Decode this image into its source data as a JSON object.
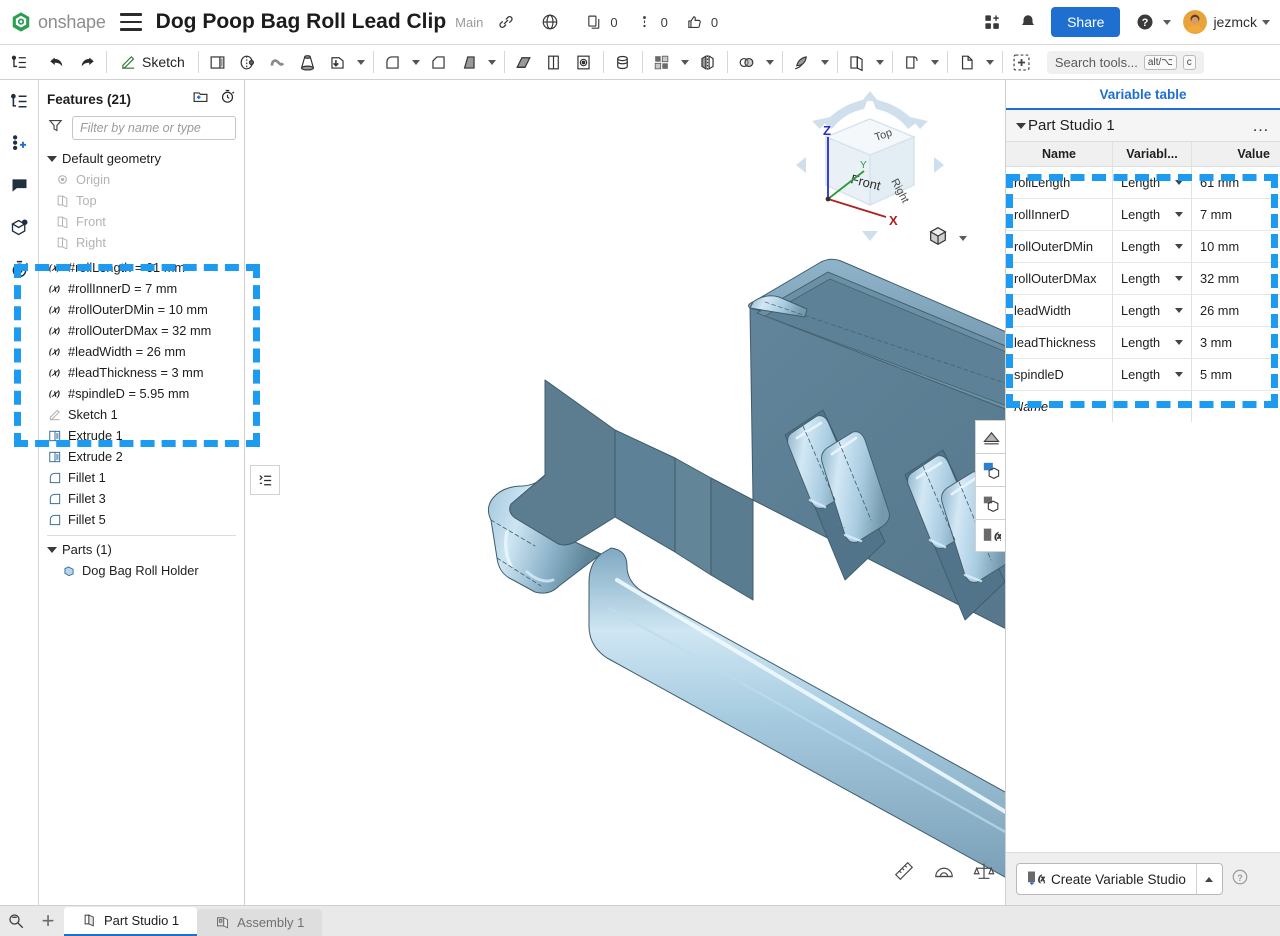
{
  "topbar": {
    "logo_text": "onshape",
    "menu_icon": "hamburger-icon",
    "doc_title": "Dog Poop Bag Roll Lead Clip",
    "branch": "Main",
    "link_icon": "link-icon",
    "globe_icon": "globe-icon",
    "copy_count": "0",
    "comment_count": "0",
    "like_count": "0",
    "apps_icon": "apps-grid-icon",
    "bell_icon": "notification-icon",
    "share_label": "Share",
    "help_icon": "help-icon",
    "username": "jezmck"
  },
  "feature_toolbar": {
    "tree_icon": "feature-tree-icon",
    "undo_icon": "undo-icon",
    "redo_icon": "redo-icon",
    "sketch_label": "Sketch",
    "tools": [
      "extrude-icon",
      "revolve-icon",
      "sweep-icon",
      "loft-icon",
      "thicken-icon",
      "fillet-icon",
      "chamfer-icon",
      "draft-icon",
      "shell-icon",
      "rib-icon",
      "hole-icon",
      "boolean-icon",
      "pattern-icon",
      "mirror-icon",
      "transform-icon",
      "split-icon",
      "plane-icon",
      "sheet-metal-icon",
      "insert-icon"
    ],
    "search_placeholder": "Search tools...",
    "search_kbd_1": "alt/⌥",
    "search_kbd_2": "c"
  },
  "left_rail": {
    "items": [
      {
        "name": "feature-list-icon"
      },
      {
        "name": "add-instance-icon"
      },
      {
        "name": "comments-icon"
      },
      {
        "name": "versions-icon"
      },
      {
        "name": "history-icon"
      }
    ]
  },
  "feature_tree": {
    "title": "Features (21)",
    "new_folder_icon": "new-folder-icon",
    "rollback_icon": "rollback-timer-icon",
    "filter_icon": "filter-icon",
    "filter_placeholder": "Filter by name or type",
    "default_geometry_label": "Default geometry",
    "default_geometry": [
      {
        "label": "Origin",
        "icon": "origin-icon"
      },
      {
        "label": "Top",
        "icon": "plane-icon"
      },
      {
        "label": "Front",
        "icon": "plane-icon"
      },
      {
        "label": "Right",
        "icon": "plane-icon"
      }
    ],
    "variables": [
      {
        "label": "#rollLength = 61 mm",
        "icon": "variable-icon"
      },
      {
        "label": "#rollInnerD = 7 mm",
        "icon": "variable-icon"
      },
      {
        "label": "#rollOuterDMin = 10 mm",
        "icon": "variable-icon"
      },
      {
        "label": "#rollOuterDMax = 32 mm",
        "icon": "variable-icon"
      },
      {
        "label": "#leadWidth = 26 mm",
        "icon": "variable-icon"
      },
      {
        "label": "#leadThickness = 3 mm",
        "icon": "variable-icon"
      },
      {
        "label": "#spindleD = 5.95 mm",
        "icon": "variable-icon"
      }
    ],
    "features": [
      {
        "label": "Sketch 1",
        "icon": "sketch-icon",
        "dim": true
      },
      {
        "label": "Extrude 1",
        "icon": "extrude-icon",
        "dim": false
      },
      {
        "label": "Extrude 2",
        "icon": "extrude-icon",
        "dim": false
      },
      {
        "label": "Fillet 1",
        "icon": "fillet-icon",
        "dim": false
      },
      {
        "label": "Fillet 3",
        "icon": "fillet-icon",
        "dim": false
      },
      {
        "label": "Fillet 5",
        "icon": "fillet-icon",
        "dim": false
      }
    ],
    "parts_label": "Parts (1)",
    "parts": [
      {
        "label": "Dog Bag Roll Holder",
        "icon": "part-icon"
      }
    ]
  },
  "viewport": {
    "viewcube": {
      "top_face": "Top",
      "front_face": "Front",
      "right_face": "Right",
      "axis_z": "Z",
      "axis_y": "Y",
      "axis_x": "X"
    },
    "view_dropdown_icon": "view-orientation-icon",
    "tree_toggle_icon": "feature-list-toggle-icon",
    "right_tools": [
      "section-view-icon",
      "render-studio-icon",
      "display-state-icon",
      "variable-studio-icon"
    ],
    "bottom_tools": [
      "measure-icon",
      "protractor-icon",
      "mass-properties-icon"
    ],
    "model_colors": {
      "face_dark": "#5b7d8f",
      "face_mid": "#8fb6cc",
      "face_light": "#b9d6e8",
      "edge": "#3f5c6b"
    }
  },
  "variable_panel": {
    "tab_label": "Variable table",
    "studio_name": "Part Studio 1",
    "more_icon": "more-options-icon",
    "columns": [
      "Name",
      "Variabl...",
      "Value"
    ],
    "rows": [
      {
        "name": "rollLength",
        "type": "Length",
        "value": "61 mm"
      },
      {
        "name": "rollInnerD",
        "type": "Length",
        "value": "7 mm"
      },
      {
        "name": "rollOuterDMin",
        "type": "Length",
        "value": "10 mm"
      },
      {
        "name": "rollOuterDMax",
        "type": "Length",
        "value": "32 mm"
      },
      {
        "name": "leadWidth",
        "type": "Length",
        "value": "26 mm"
      },
      {
        "name": "leadThickness",
        "type": "Length",
        "value": "3 mm"
      },
      {
        "name": "spindleD",
        "type": "Length",
        "value": "5 mm"
      }
    ],
    "new_row_placeholder": "Name",
    "create_button_label": "Create Variable Studio",
    "create_button_icon": "variable-studio-icon",
    "help_icon": "help-circle-icon"
  },
  "bottom_bar": {
    "search_icon": "search-document-icon",
    "add_tab_label": "+",
    "tabs": [
      {
        "label": "Part Studio 1",
        "icon": "part-studio-icon",
        "active": true
      },
      {
        "label": "Assembly 1",
        "icon": "assembly-icon",
        "active": false
      }
    ]
  },
  "highlights": {
    "accent": "#1d9bf0",
    "regions": [
      "feature-tree-variables",
      "variable-table-rows"
    ]
  }
}
